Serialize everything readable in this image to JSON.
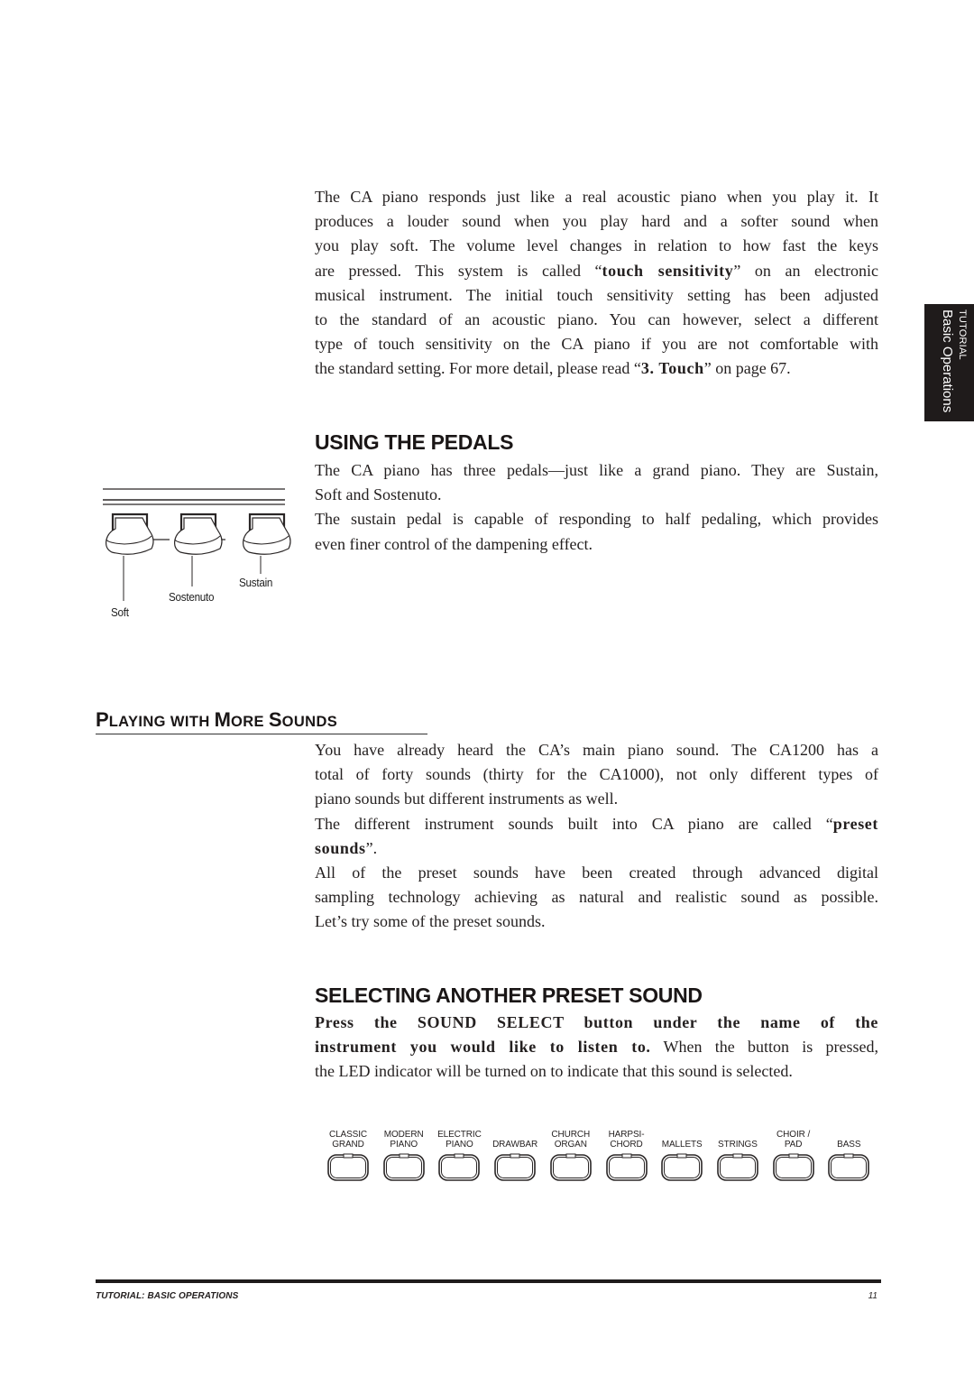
{
  "intro": {
    "lines": [
      "The CA piano responds just like a real acoustic piano when you play it.  It",
      "produces a louder sound when you play hard and a softer sound when",
      "you play soft.  The volume level changes in relation to how fast the keys",
      [
        "are pressed.  This system is called “",
        "touch sensitivity",
        "” on an electronic"
      ],
      "musical instrument.  The initial touch sensitivity setting has been adjusted",
      "to the standard of an acoustic piano.   You can however, select a different",
      "type of touch sensitivity on the CA piano if you are not comfortable with",
      [
        "the standard setting.  For more detail, please read “",
        "3. Touch",
        "” on page 67."
      ]
    ]
  },
  "side_tab": {
    "line1": "TUTORIAL",
    "line2": "Basic Operations"
  },
  "pedals": {
    "heading": "USING THE PEDALS",
    "lines": [
      " The CA piano has three pedals—just like a grand piano.  They are Sustain,",
      "Soft and Sostenuto.",
      "The sustain pedal is capable of responding to half pedaling, which provides",
      "even finer control of the dampening effect."
    ],
    "figure_labels": {
      "soft": "Soft",
      "sostenuto": "Sostenuto",
      "sustain": "Sustain"
    }
  },
  "more_sounds": {
    "heading_parts": [
      {
        "text": "P",
        "size": "big"
      },
      {
        "text": "LAYING WITH ",
        "size": "small"
      },
      {
        "text": "M",
        "size": "big"
      },
      {
        "text": "ORE ",
        "size": "small"
      },
      {
        "text": "S",
        "size": "big"
      },
      {
        "text": "OUNDS",
        "size": "small"
      }
    ],
    "lines": [
      "You have already heard the CA’s main piano sound.  The CA1200 has a",
      "total of forty sounds (thirty for the CA1000), not only different types of",
      "piano sounds but different instruments as well.",
      [
        "The different instrument sounds built into CA piano are called “",
        "preset",
        ""
      ],
      [
        "",
        "sounds",
        "”."
      ],
      "All of the preset sounds have been created through advanced digital",
      "sampling technology achieving as natural and realistic sound as possible.",
      "Let’s try some of the preset sounds."
    ]
  },
  "select_sound": {
    "heading": "SELECTING ANOTHER PRESET SOUND",
    "lines": [
      [
        "",
        "Press the SOUND SELECT button under the name of the",
        ""
      ],
      [
        "",
        "instrument you would like to listen to.",
        "  When the button is pressed,"
      ],
      "the LED indicator will be turned on to indicate that this sound is selected."
    ],
    "buttons": [
      {
        "line1": "CLASSIC",
        "line2": "GRAND"
      },
      {
        "line1": "MODERN",
        "line2": "PIANO"
      },
      {
        "line1": "ELECTRIC",
        "line2": "PIANO"
      },
      {
        "line1": "",
        "line2": "DRAWBAR"
      },
      {
        "line1": "CHURCH",
        "line2": "ORGAN"
      },
      {
        "line1": "HARPSI-",
        "line2": "CHORD"
      },
      {
        "line1": "",
        "line2": "MALLETS"
      },
      {
        "line1": "",
        "line2": "STRINGS"
      },
      {
        "line1": "CHOIR /",
        "line2": "PAD"
      },
      {
        "line1": "",
        "line2": "BASS"
      }
    ]
  },
  "footer": {
    "section": "TUTORIAL:  BASIC OPERATIONS",
    "page": "11"
  }
}
